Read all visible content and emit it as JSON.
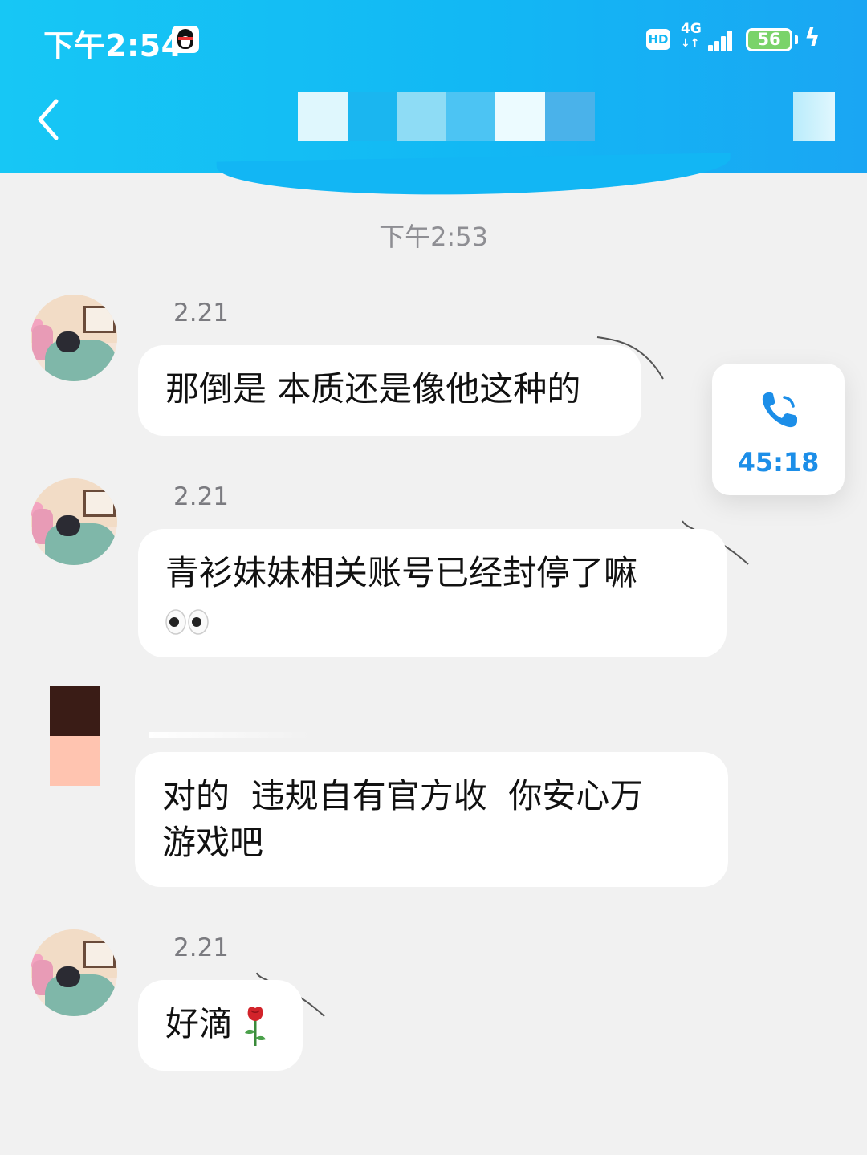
{
  "status_bar": {
    "time": "下午2:54",
    "hd_label": "HD",
    "network_label": "4G",
    "network_arrows": "↓↑",
    "battery_level": "56"
  },
  "chat": {
    "divider_time": "下午2:53",
    "messages": [
      {
        "sender_label": "2.21",
        "text": "那倒是 本质还是像他这种的",
        "emoji": ""
      },
      {
        "sender_label": "2.21",
        "text": "青衫妹妹相关账号已经封停了嘛",
        "emoji": "eyes-emoji"
      },
      {
        "sender_label": "",
        "text": "对的  违规自有官方收  你安心万\n游戏吧",
        "emoji": ""
      },
      {
        "sender_label": "2.21",
        "text": "好滴",
        "emoji": "rose-emoji"
      }
    ]
  },
  "call_card": {
    "duration": "45:18",
    "accent_color": "#1c8ee8"
  },
  "colors": {
    "header_accent": "#12b8f4",
    "background": "#f1f1f1",
    "bubble": "#ffffff"
  }
}
